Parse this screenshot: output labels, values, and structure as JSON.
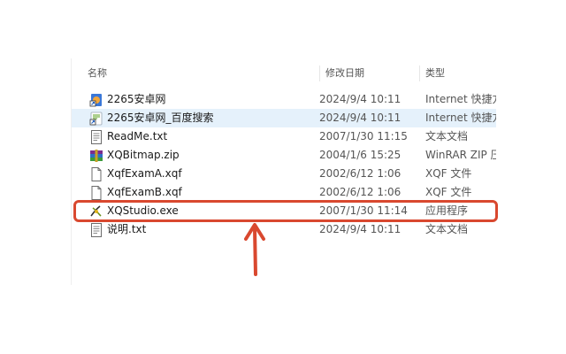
{
  "columns": {
    "name": "名称",
    "date": "修改日期",
    "type": "类型"
  },
  "files": [
    {
      "name": "2265安卓网",
      "date": "2024/9/4 10:11",
      "type": "Internet 快捷方式",
      "icon": "internet-shortcut-icon",
      "selected": false
    },
    {
      "name": "2265安卓网_百度搜索",
      "date": "2024/9/4 10:11",
      "type": "Internet 快捷方式",
      "icon": "internet-shortcut-icon",
      "selected": true
    },
    {
      "name": "ReadMe.txt",
      "date": "2007/1/30 11:15",
      "type": "文本文档",
      "icon": "text-file-icon",
      "selected": false
    },
    {
      "name": "XQBitmap.zip",
      "date": "2004/1/6 15:25",
      "type": "WinRAR ZIP 压缩文件",
      "icon": "winrar-zip-icon",
      "selected": false
    },
    {
      "name": "XqfExamA.xqf",
      "date": "2002/6/12 1:06",
      "type": "XQF 文件",
      "icon": "blank-file-icon",
      "selected": false
    },
    {
      "name": "XqfExamB.xqf",
      "date": "2002/6/12 1:06",
      "type": "XQF 文件",
      "icon": "blank-file-icon",
      "selected": false
    },
    {
      "name": "XQStudio.exe",
      "date": "2007/1/30 11:14",
      "type": "应用程序",
      "icon": "xqstudio-app-icon",
      "selected": false
    },
    {
      "name": "说明.txt",
      "date": "2024/9/4 10:11",
      "type": "文本文档",
      "icon": "text-file-icon",
      "selected": false
    }
  ],
  "colors": {
    "highlight": "#d9482f",
    "selection": "#e5f1fb"
  }
}
